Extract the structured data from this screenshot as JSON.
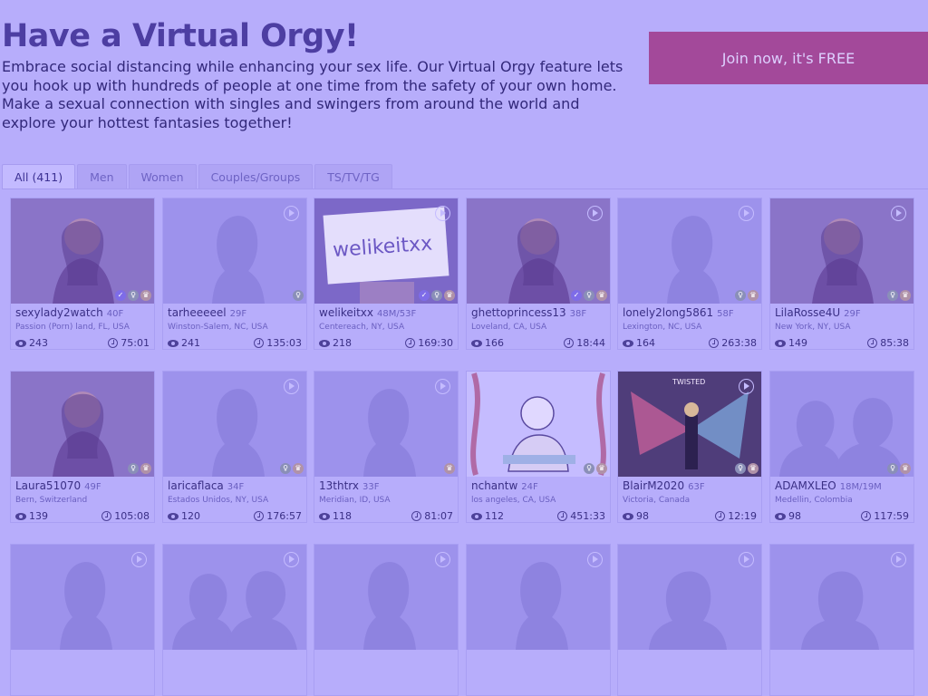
{
  "header": {
    "title": "Have a Virtual Orgy!",
    "intro": "Embrace social distancing while enhancing your sex life. Our Virtual Orgy feature lets you hook up with hundreds of people at one time from the safety of your own home. Make a sexual connection with singles and swingers from around the world and explore your hottest fantasies together!",
    "join_label": "Join now, it's FREE"
  },
  "tabs": [
    "All (411)",
    "Men",
    "Women",
    "Couples/Groups",
    "TS/TV/TG"
  ],
  "colors": {
    "background": "#b7adfb",
    "join_button": "#a3499a",
    "text": "#3a2f85"
  },
  "profiles": [
    {
      "name": "sexylady2watch",
      "age": "40F",
      "location": "Passion (Porn) land, FL, USA",
      "views": "243",
      "time": "75:01",
      "photo": "woman-photo",
      "play": false,
      "badges": [
        "verified",
        "gender",
        "crown"
      ]
    },
    {
      "name": "tarheeeeel",
      "age": "29F",
      "location": "Winston-Salem, NC, USA",
      "views": "241",
      "time": "135:03",
      "photo": "female-silhouette",
      "play": true,
      "badges": [
        "gender"
      ]
    },
    {
      "name": "welikeitxx",
      "age": "48M/53F",
      "location": "Centereach, NY, USA",
      "views": "218",
      "time": "169:30",
      "photo": "sign-photo",
      "play": true,
      "badges": [
        "verified",
        "gender",
        "crown"
      ]
    },
    {
      "name": "ghettoprincess13",
      "age": "38F",
      "location": "Loveland, CA, USA",
      "views": "166",
      "time": "18:44",
      "photo": "woman-photo",
      "play": true,
      "badges": [
        "verified",
        "gender",
        "crown"
      ]
    },
    {
      "name": "lonely2long5861",
      "age": "58F",
      "location": "Lexington, NC, USA",
      "views": "164",
      "time": "263:38",
      "photo": "female-silhouette",
      "play": true,
      "badges": [
        "gender",
        "crown"
      ]
    },
    {
      "name": "LilaRosse4U",
      "age": "29F",
      "location": "New York, NY, USA",
      "views": "149",
      "time": "85:38",
      "photo": "woman-photo",
      "play": true,
      "badges": [
        "gender",
        "crown"
      ]
    },
    {
      "name": "Laura51070",
      "age": "49F",
      "location": "Bern, Switzerland",
      "views": "139",
      "time": "105:08",
      "photo": "woman-photo",
      "play": false,
      "badges": [
        "gender",
        "crown"
      ]
    },
    {
      "name": "laricaflaca",
      "age": "34F",
      "location": "Estados Unidos, NY, USA",
      "views": "120",
      "time": "176:57",
      "photo": "female-silhouette",
      "play": true,
      "badges": [
        "gender",
        "crown"
      ]
    },
    {
      "name": "13thtrx",
      "age": "33F",
      "location": "Meridian, ID, USA",
      "views": "118",
      "time": "81:07",
      "photo": "female-silhouette",
      "play": true,
      "badges": [
        "crown"
      ]
    },
    {
      "name": "nchantw",
      "age": "24F",
      "location": "los angeles, CA, USA",
      "views": "112",
      "time": "451:33",
      "photo": "drawing-photo",
      "play": false,
      "badges": [
        "gender",
        "crown"
      ]
    },
    {
      "name": "BlairM2020",
      "age": "63F",
      "location": "Victoria, Canada",
      "views": "98",
      "time": "12:19",
      "photo": "art-photo",
      "play": true,
      "badges": [
        "gender",
        "crown"
      ]
    },
    {
      "name": "ADAMXLEO",
      "age": "18M/19M",
      "location": "Medellin, Colombia",
      "views": "98",
      "time": "117:59",
      "photo": "couple-silhouette",
      "play": false,
      "badges": [
        "gender",
        "crown"
      ]
    },
    {
      "photo": "female-silhouette",
      "play": true,
      "badges": []
    },
    {
      "photo": "couple-silhouette",
      "play": true,
      "badges": []
    },
    {
      "photo": "female-silhouette",
      "play": true,
      "badges": []
    },
    {
      "photo": "female-silhouette",
      "play": true,
      "badges": []
    },
    {
      "photo": "male-silhouette",
      "play": true,
      "badges": []
    },
    {
      "photo": "male-silhouette",
      "play": true,
      "badges": []
    }
  ]
}
